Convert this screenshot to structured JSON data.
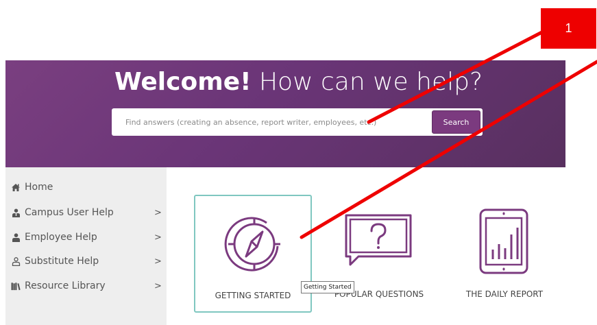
{
  "hero": {
    "title_bold": "Welcome!",
    "title_rest": " How can we help?"
  },
  "search": {
    "placeholder": "Find answers (creating an absence, report writer, employees, etc.)",
    "button_label": "Search"
  },
  "sidebar": {
    "items": [
      {
        "label": "Home",
        "icon": "home-icon"
      },
      {
        "label": "Campus User Help",
        "icon": "campus-user-icon",
        "chevron": ">"
      },
      {
        "label": "Employee Help",
        "icon": "employee-icon",
        "chevron": ">"
      },
      {
        "label": "Substitute Help",
        "icon": "substitute-icon",
        "chevron": ">"
      },
      {
        "label": "Resource Library",
        "icon": "books-icon",
        "chevron": ">"
      }
    ]
  },
  "cards": [
    {
      "label": "GETTING STARTED",
      "icon": "compass-icon"
    },
    {
      "label": "POPULAR QUESTIONS",
      "icon": "question-icon"
    },
    {
      "label": "THE DAILY REPORT",
      "icon": "tablet-chart-icon"
    }
  ],
  "tooltip": {
    "text": "Getting Started"
  },
  "annotation": {
    "number": "1"
  },
  "colors": {
    "brand_purple": "#6e3778",
    "icon_purple": "#7b3a7f",
    "active_border": "#7fc7c0",
    "annotation_red": "#ee0000"
  }
}
